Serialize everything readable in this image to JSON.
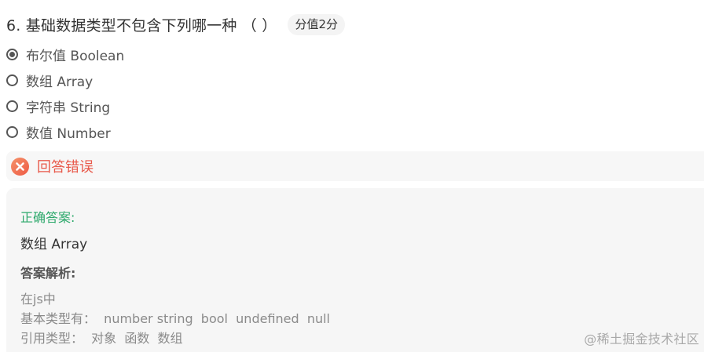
{
  "question": {
    "title": "6. 基础数据类型不包含下列哪一种 （ ）",
    "score": "分值2分"
  },
  "options": [
    {
      "label": "布尔值 Boolean",
      "selected": true
    },
    {
      "label": "数组 Array",
      "selected": false
    },
    {
      "label": "字符串 String",
      "selected": false
    },
    {
      "label": "数值 Number",
      "selected": false
    }
  ],
  "result": {
    "icon": "close-circle-icon",
    "text": "回答错误",
    "color": "#e8594a"
  },
  "answer": {
    "heading": "正确答案:",
    "value": "数组 Array",
    "heading_color": "#2ba86a"
  },
  "analysis": {
    "heading": "答案解析:",
    "lines": [
      "在js中",
      "基本类型有：  number string  bool  undefined  null",
      "引用类型：  对象  函数  数组"
    ]
  },
  "watermark": "@稀土掘金技术社区"
}
